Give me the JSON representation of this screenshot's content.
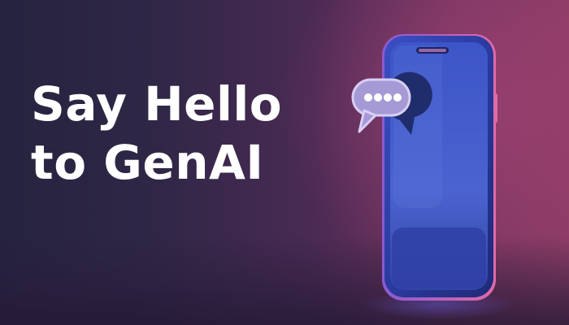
{
  "headline": {
    "line1": "Say Hello",
    "line2": "to GenAI"
  },
  "colors": {
    "text": "#ffffff",
    "background_left": "#25233f",
    "background_right": "#8f3d66",
    "phone_body": "#2b3a9e",
    "phone_edge": "#e06aa8",
    "bubble": "#a59ad6"
  },
  "icons": {
    "phone": "smartphone-icon",
    "chat_bubble": "chat-bubble-icon"
  }
}
